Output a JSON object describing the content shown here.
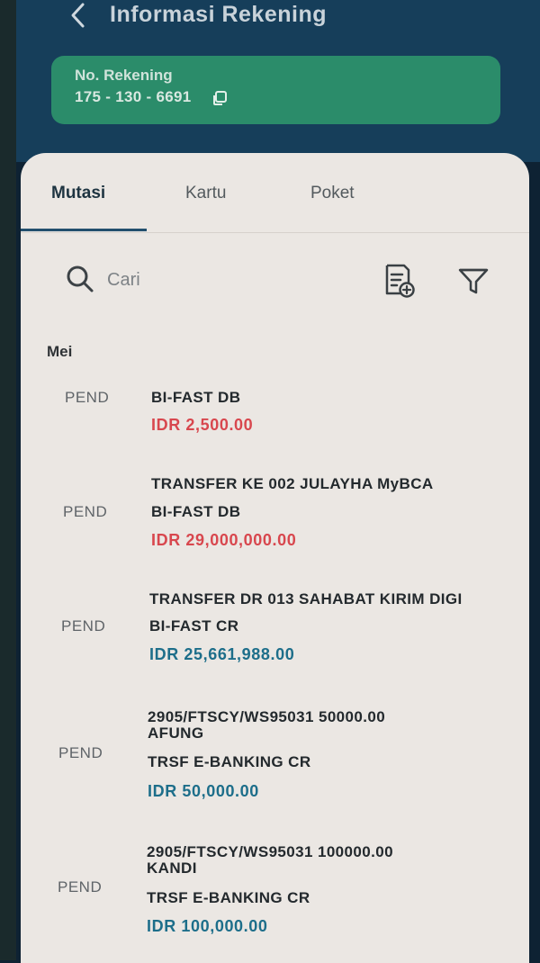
{
  "header": {
    "back_icon": "chevron-left-icon",
    "title": "Informasi Rekening"
  },
  "account": {
    "label": "No. Rekening",
    "number": "175 - 130 - 6691",
    "copy_icon": "copy-icon"
  },
  "tabs": [
    {
      "label": "Mutasi",
      "active": true
    },
    {
      "label": "Kartu",
      "active": false
    },
    {
      "label": "Poket",
      "active": false
    }
  ],
  "search": {
    "placeholder": "Cari",
    "icon": "search-icon"
  },
  "toolbar": {
    "statement_icon": "document-add-icon",
    "filter_icon": "filter-icon"
  },
  "month": "Mei",
  "colors": {
    "debit": "#d8474e",
    "credit": "#1d6e8a",
    "card": "#2b8c6a",
    "header": "#163e5a"
  },
  "transactions": [
    {
      "status": "PEND",
      "lines": [
        "BI-FAST DB"
      ],
      "amount": "IDR 2,500.00",
      "type": "debit"
    },
    {
      "status": "PEND",
      "lines": [
        "TRANSFER   KE 002 JULAYHA MyBCA",
        "BI-FAST DB"
      ],
      "amount": "IDR 29,000,000.00",
      "type": "debit"
    },
    {
      "status": "PEND",
      "lines": [
        "TRANSFER   DR 013 SAHABAT KIRIM DIGI",
        "BI-FAST CR"
      ],
      "amount": "IDR 25,661,988.00",
      "type": "credit"
    },
    {
      "status": "PEND",
      "lines": [
        "2905/FTSCY/WS95031 50000.00",
        "AFUNG",
        "TRSF E-BANKING CR"
      ],
      "amount": "IDR 50,000.00",
      "type": "credit"
    },
    {
      "status": "PEND",
      "lines": [
        "2905/FTSCY/WS95031 100000.00",
        "KANDI",
        "TRSF E-BANKING CR"
      ],
      "amount": "IDR 100,000.00",
      "type": "credit"
    }
  ]
}
